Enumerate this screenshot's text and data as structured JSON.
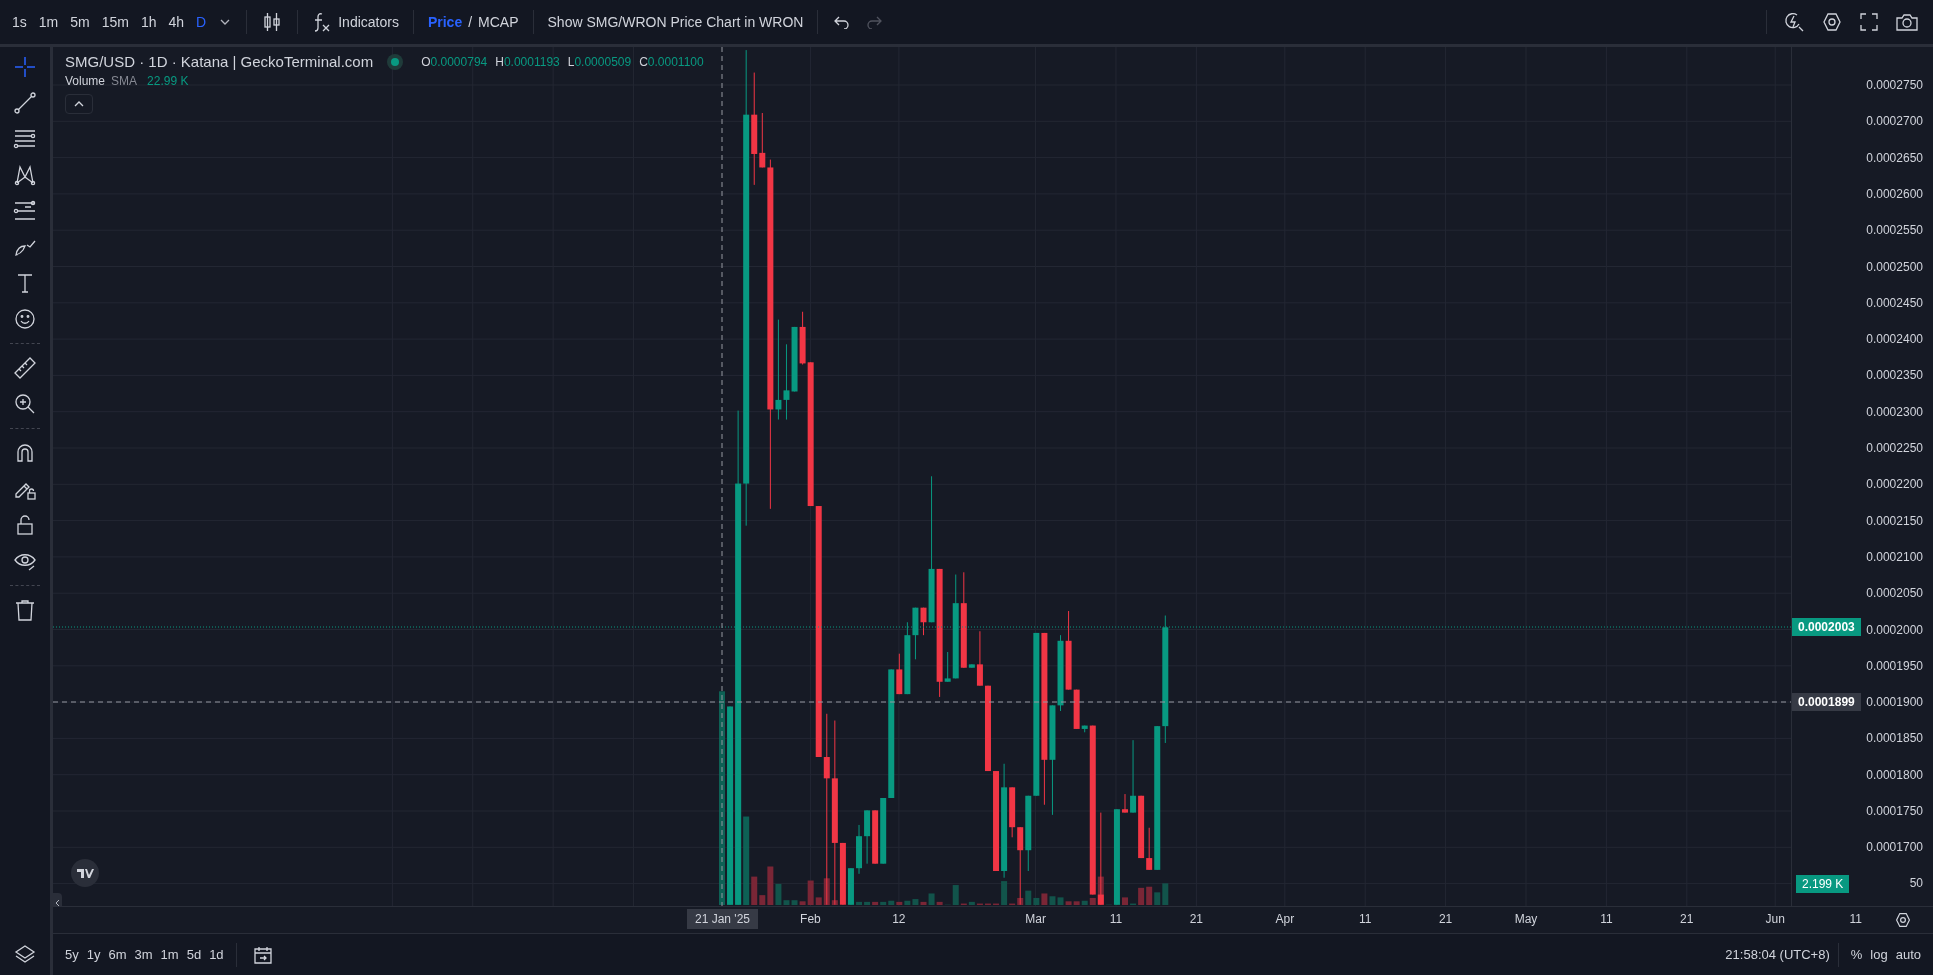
{
  "top_bar": {
    "intervals": [
      {
        "label": "1s",
        "selected": false
      },
      {
        "label": "1m",
        "selected": false
      },
      {
        "label": "5m",
        "selected": false
      },
      {
        "label": "15m",
        "selected": false
      },
      {
        "label": "1h",
        "selected": false
      },
      {
        "label": "4h",
        "selected": false
      },
      {
        "label": "D",
        "selected": true
      }
    ],
    "indicators": "Indicators",
    "price_mode": [
      {
        "label": "Price",
        "selected": true
      },
      {
        "label": "MCAP",
        "selected": false
      }
    ],
    "separator": "/",
    "compare": "Show SMG/WRON Price Chart in WRON"
  },
  "legend": {
    "title": "SMG/USD · 1D · Katana | GeckoTerminal.com",
    "ohlc": [
      {
        "key": "O",
        "value": "0.0000794"
      },
      {
        "key": "H",
        "value": "0.0001193"
      },
      {
        "key": "L",
        "value": "0.0000509"
      },
      {
        "key": "C",
        "value": "0.0001100"
      }
    ],
    "volume": {
      "label": "Volume",
      "ma": "SMA",
      "value": "22.99 K"
    }
  },
  "price_axis": {
    "ticks": [
      "0.0002750",
      "0.0002700",
      "0.0002650",
      "0.0002600",
      "0.0002550",
      "0.0002500",
      "0.0002450",
      "0.0002400",
      "0.0002350",
      "0.0002300",
      "0.0002250",
      "0.0002200",
      "0.0002150",
      "0.0002100",
      "0.0002050",
      "0.0002000",
      "0.0001950",
      "0.0001900",
      "0.0001850",
      "0.0001800",
      "0.0001750",
      "0.0001700"
    ],
    "last_price": "0.0002003",
    "crosshair_price": "0.0001899",
    "volume_badge": "2.199 K",
    "covered_tick": "50"
  },
  "time_axis": {
    "crosshair_date": "21 Jan '25",
    "labels": [
      "Feb",
      "12",
      "Mar",
      "11",
      "21",
      "Apr",
      "11",
      "21",
      "May",
      "11",
      "21",
      "Jun",
      "11"
    ]
  },
  "bottom_bar": {
    "ranges": [
      "5y",
      "1y",
      "6m",
      "3m",
      "1m",
      "5d",
      "1d"
    ],
    "clock": "21:58:04 (UTC+8)",
    "options": [
      "%",
      "log",
      "auto"
    ]
  }
}
